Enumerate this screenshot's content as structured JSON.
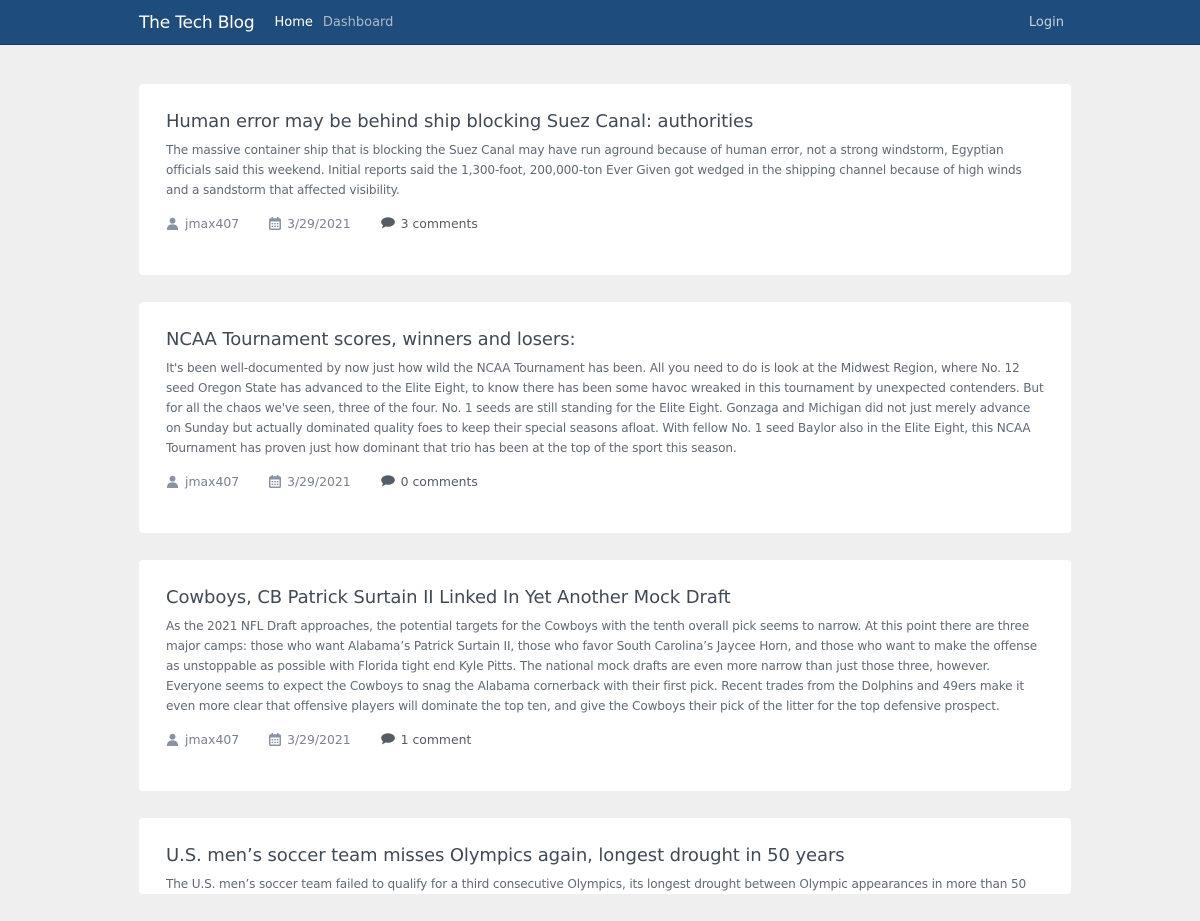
{
  "nav": {
    "brand": "The Tech Blog",
    "links": [
      "Home",
      "Dashboard"
    ],
    "login": "Login"
  },
  "colors": {
    "navbar": "#1e4c7c",
    "background": "#efefef",
    "card": "#ffffff"
  },
  "posts": [
    {
      "title": "Human error may be behind ship blocking Suez Canal: authorities",
      "body": "The massive container ship that is blocking the Suez Canal may have run aground because of human error, not a strong windstorm, Egyptian officials said this weekend. Initial reports said the 1,300-foot, 200,000-ton Ever Given got wedged in the shipping channel because of high winds and a sandstorm that affected visibility.",
      "author": "jmax407",
      "date": "3/29/2021",
      "comments": "3 comments"
    },
    {
      "title": "NCAA Tournament scores, winners and losers:",
      "body": "It's been well-documented by now just how wild the NCAA Tournament has been. All you need to do is look at the Midwest Region, where No. 12 seed Oregon State has advanced to the Elite Eight, to know there has been some havoc wreaked in this tournament by unexpected contenders. But for all the chaos we've seen, three of the four. No. 1 seeds are still standing for the Elite Eight. Gonzaga and Michigan did not just merely advance on Sunday but actually dominated quality foes to keep their special seasons afloat. With fellow No. 1 seed Baylor also in the Elite Eight, this NCAA Tournament has proven just how dominant that trio has been at the top of the sport this season.",
      "author": "jmax407",
      "date": "3/29/2021",
      "comments": "0 comments"
    },
    {
      "title": "Cowboys, CB Patrick Surtain II Linked In Yet Another Mock Draft",
      "body": "As the 2021 NFL Draft approaches, the potential targets for the Cowboys with the tenth overall pick seems to narrow. At this point there are three major camps: those who want Alabama’s Patrick Surtain II, those who favor South Carolina’s Jaycee Horn, and those who want to make the offense as unstoppable as possible with Florida tight end Kyle Pitts. The national mock drafts are even more narrow than just those three, however. Everyone seems to expect the Cowboys to snag the Alabama cornerback with their first pick. Recent trades from the Dolphins and 49ers make it even more clear that offensive players will dominate the top ten, and give the Cowboys their pick of the litter for the top defensive prospect.",
      "author": "jmax407",
      "date": "3/29/2021",
      "comments": "1 comment"
    },
    {
      "title": "U.S. men’s soccer team misses Olympics again, longest drought in 50 years",
      "body": "The U.S. men’s soccer team failed to qualify for a third consecutive Olympics, its longest drought between Olympic appearances in more than 50",
      "author": "",
      "date": "",
      "comments": ""
    }
  ]
}
